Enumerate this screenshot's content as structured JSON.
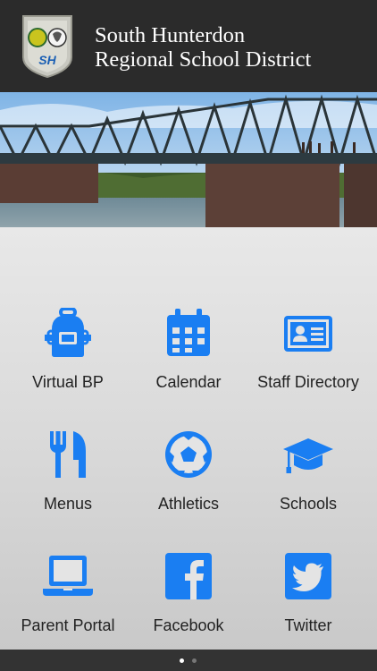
{
  "header": {
    "title_line1": "South Hunterdon",
    "title_line2": "Regional School District",
    "logo_text": "SH"
  },
  "tiles": [
    {
      "label": "Virtual BP",
      "icon": "backpack-icon"
    },
    {
      "label": "Calendar",
      "icon": "calendar-icon"
    },
    {
      "label": "Staff Directory",
      "icon": "id-card-icon"
    },
    {
      "label": "Menus",
      "icon": "fork-knife-icon"
    },
    {
      "label": "Athletics",
      "icon": "soccer-ball-icon"
    },
    {
      "label": "Schools",
      "icon": "graduation-cap-icon"
    },
    {
      "label": "Parent Portal",
      "icon": "laptop-icon"
    },
    {
      "label": "Facebook",
      "icon": "facebook-icon"
    },
    {
      "label": "Twitter",
      "icon": "twitter-icon"
    }
  ],
  "pager": {
    "pages": 2,
    "active": 1
  },
  "colors": {
    "accent": "#1a7ef2",
    "header_bg": "#2b2b2b",
    "text": "#222222"
  }
}
